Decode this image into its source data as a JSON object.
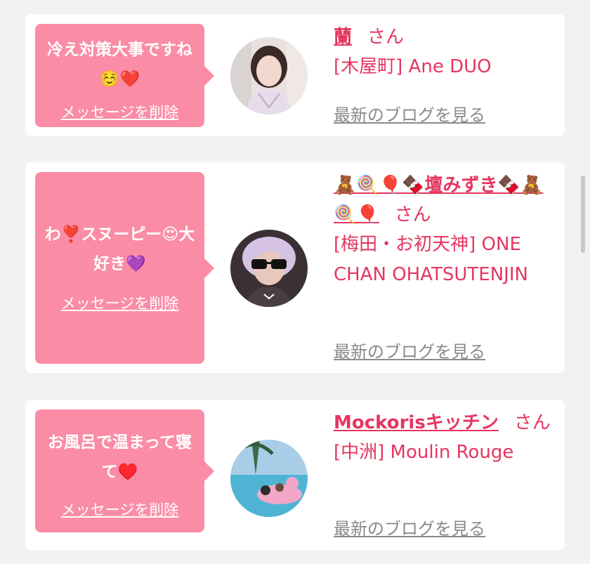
{
  "messages": [
    {
      "message": "冷え対策大事ですね☺️❤️",
      "delete_label": "メッセージを削除",
      "name": "蘭",
      "honorific": "さん",
      "shop": "[木屋町] Ane DUO",
      "blog_label": "最新のブログを見る"
    },
    {
      "message": "わ❣️スヌーピー😍大好き💜",
      "delete_label": "メッセージを削除",
      "name": "🧸🍭🎈🍫壇みずき🍫🧸🍭🎈",
      "honorific": "さん",
      "shop": "[梅田・お初天神] ONE CHAN OHATSUTENJIN",
      "blog_label": "最新のブログを見る"
    },
    {
      "message": "お風呂で温まって寝て♥️",
      "delete_label": "メッセージを削除",
      "name": "Mockorisキッチン",
      "honorific": "さん",
      "shop": "[中洲] Moulin Rouge",
      "blog_label": "最新のブログを見る"
    }
  ]
}
